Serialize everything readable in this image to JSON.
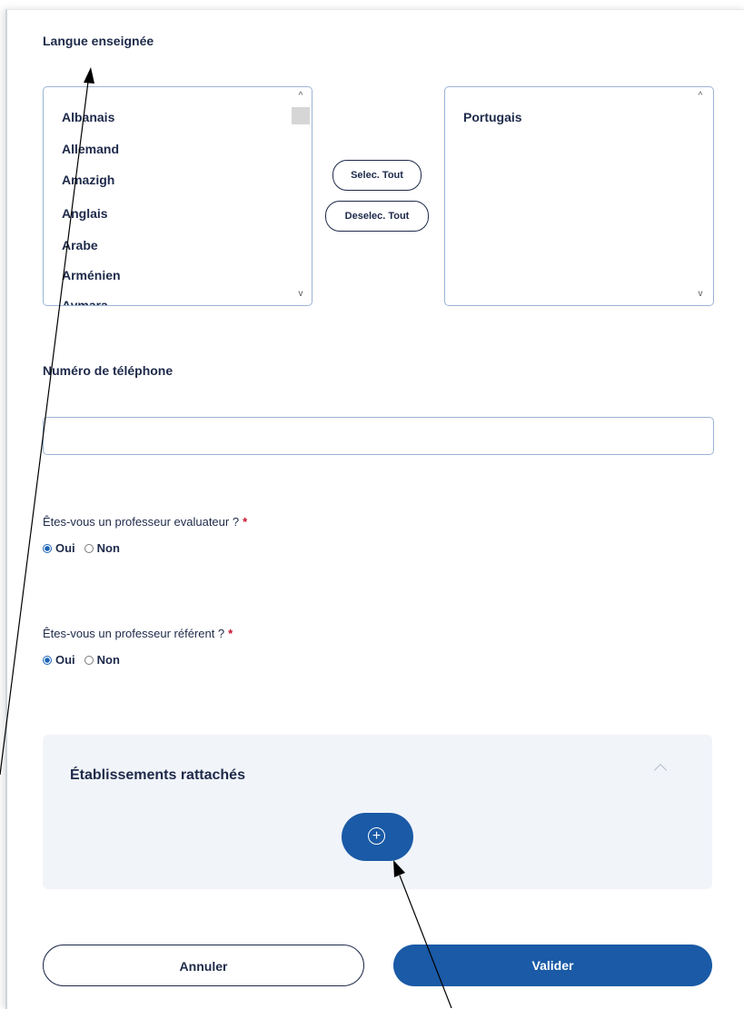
{
  "langue": {
    "label": "Langue enseignée",
    "available": [
      "Albanais",
      "Allemand",
      "Amazigh",
      "Anglais",
      "Arabe",
      "Arménien",
      "Aymara"
    ],
    "selected": [
      "Portugais"
    ],
    "select_all_label": "Selec. Tout",
    "deselect_all_label": "Deselec. Tout",
    "scroll_up_glyph": "^",
    "scroll_down_glyph": "v"
  },
  "telephone": {
    "label": "Numéro de téléphone",
    "value": ""
  },
  "evaluateur": {
    "question": "Êtes-vous un professeur evaluateur ?",
    "required_mark": "*",
    "options": [
      "Oui",
      "Non"
    ],
    "selected": "Oui"
  },
  "referent": {
    "question": "Êtes-vous un professeur référent ?",
    "required_mark": "*",
    "options": [
      "Oui",
      "Non"
    ],
    "selected": "Oui"
  },
  "etablissements": {
    "title": "Établissements rattachés",
    "add_glyph": "+"
  },
  "actions": {
    "cancel_label": "Annuler",
    "submit_label": "Valider"
  },
  "colors": {
    "primary": "#1a5aa6",
    "text": "#1e2a4a",
    "required": "#c8102e",
    "panel_bg": "#f1f4f9"
  }
}
